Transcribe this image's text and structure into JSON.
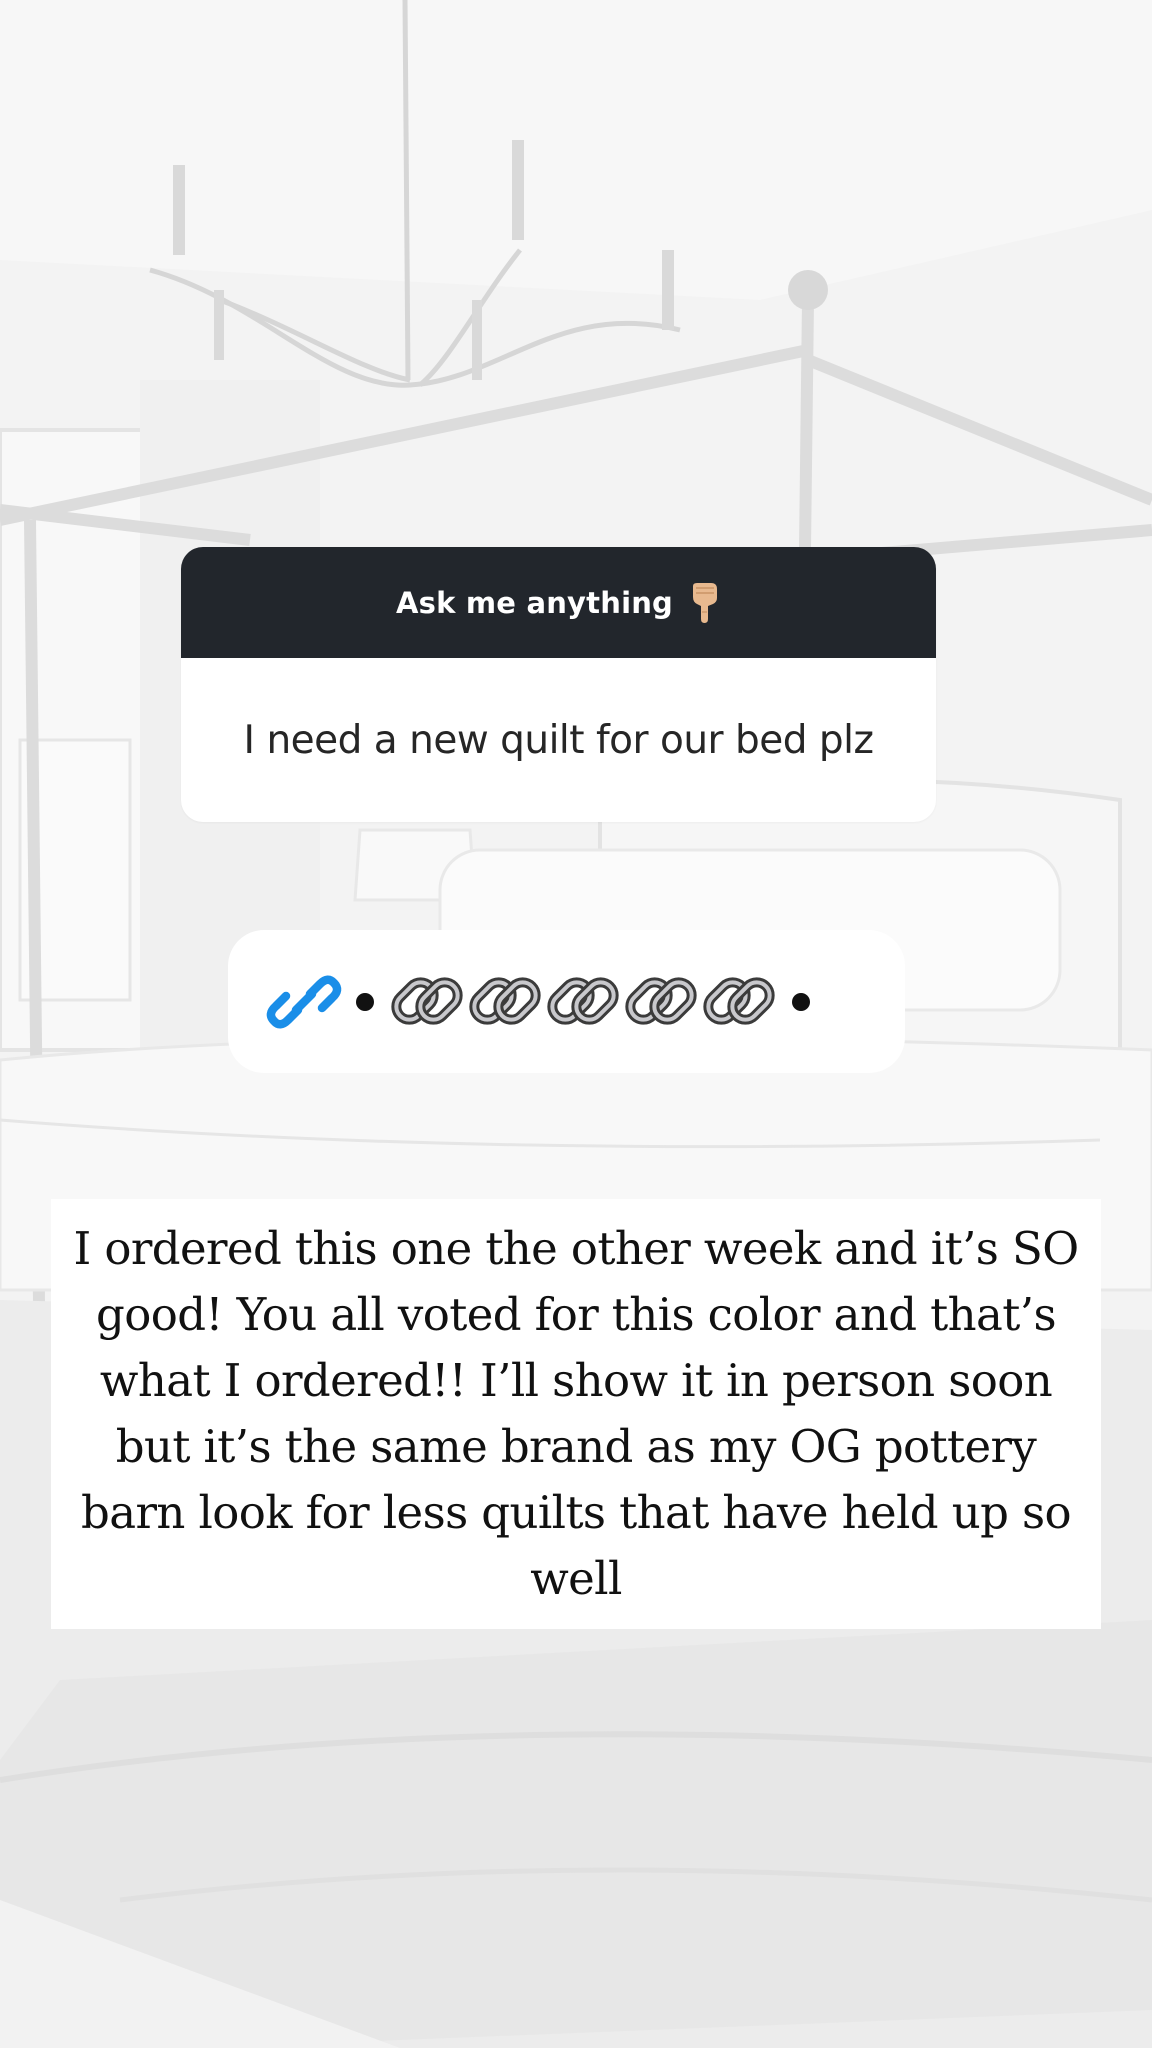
{
  "question_sticker": {
    "prompt": "Ask me anything",
    "prompt_icon": "pointing-down-hand-icon",
    "answer": "I need a new quilt for our bed plz",
    "header_color": "#22262c"
  },
  "link_sticker": {
    "link_icon": "link-icon",
    "link_icon_color": "#1a8ee8",
    "chain_icon": "chain-icon",
    "chain_count": 5
  },
  "caption": {
    "text": "I ordered this one the other week and it’s SO good! You all voted for this color and that’s what I ordered!! I’ll show it in person soon but it’s the same brand as my OG pottery barn look for less quilts that have held up so well"
  }
}
